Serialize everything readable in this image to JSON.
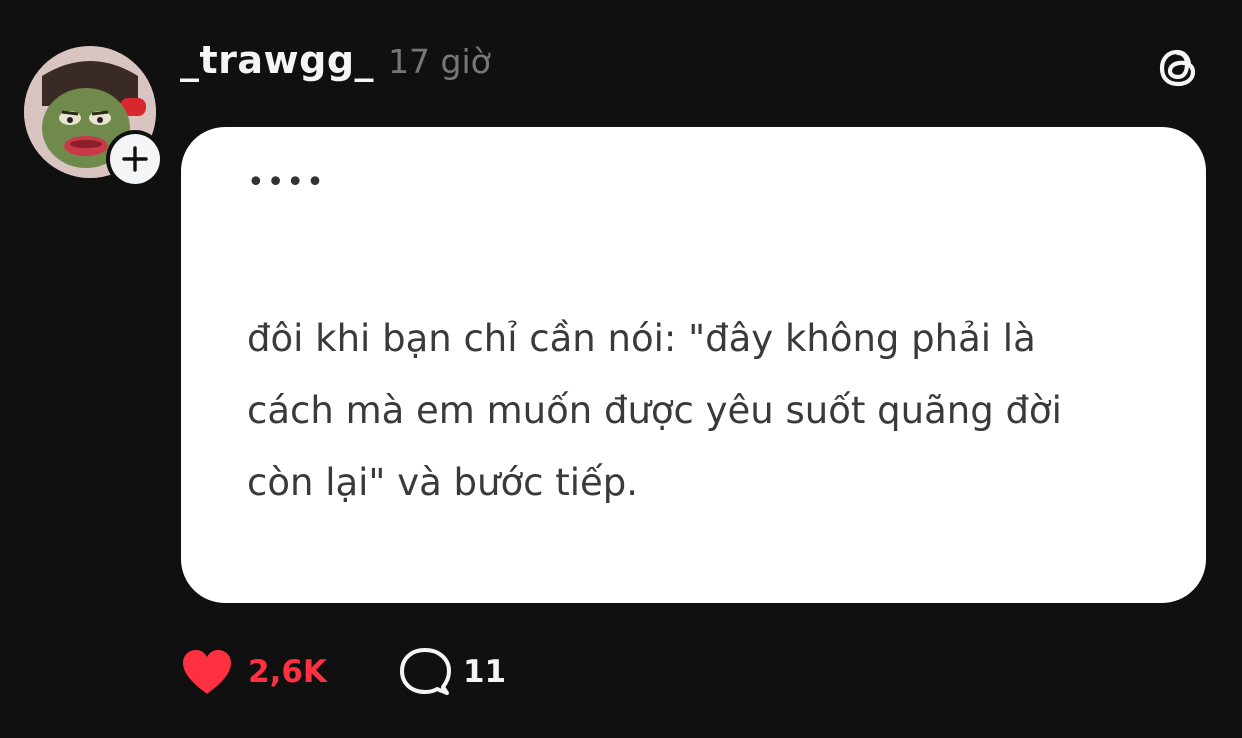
{
  "post": {
    "username": "_trawgg_",
    "timestamp": "17 giờ",
    "dots": "••••",
    "text_lines": [
      "đôi khi bạn chỉ cần nói: \"đây không phải là",
      "cách mà em muốn được yêu suốt quãng đời",
      "còn lại\" và bước tiếp."
    ]
  },
  "actions": {
    "likes": "2,6K",
    "comments": "11"
  },
  "icons": {
    "brand": "threads-logo-icon",
    "follow": "plus-icon",
    "like": "heart-icon",
    "comment": "comment-bubble-icon"
  },
  "colors": {
    "background": "#101010",
    "card": "#ffffff",
    "like_active": "#ff3040",
    "username": "#f3f5f7",
    "timestamp": "#777777"
  }
}
